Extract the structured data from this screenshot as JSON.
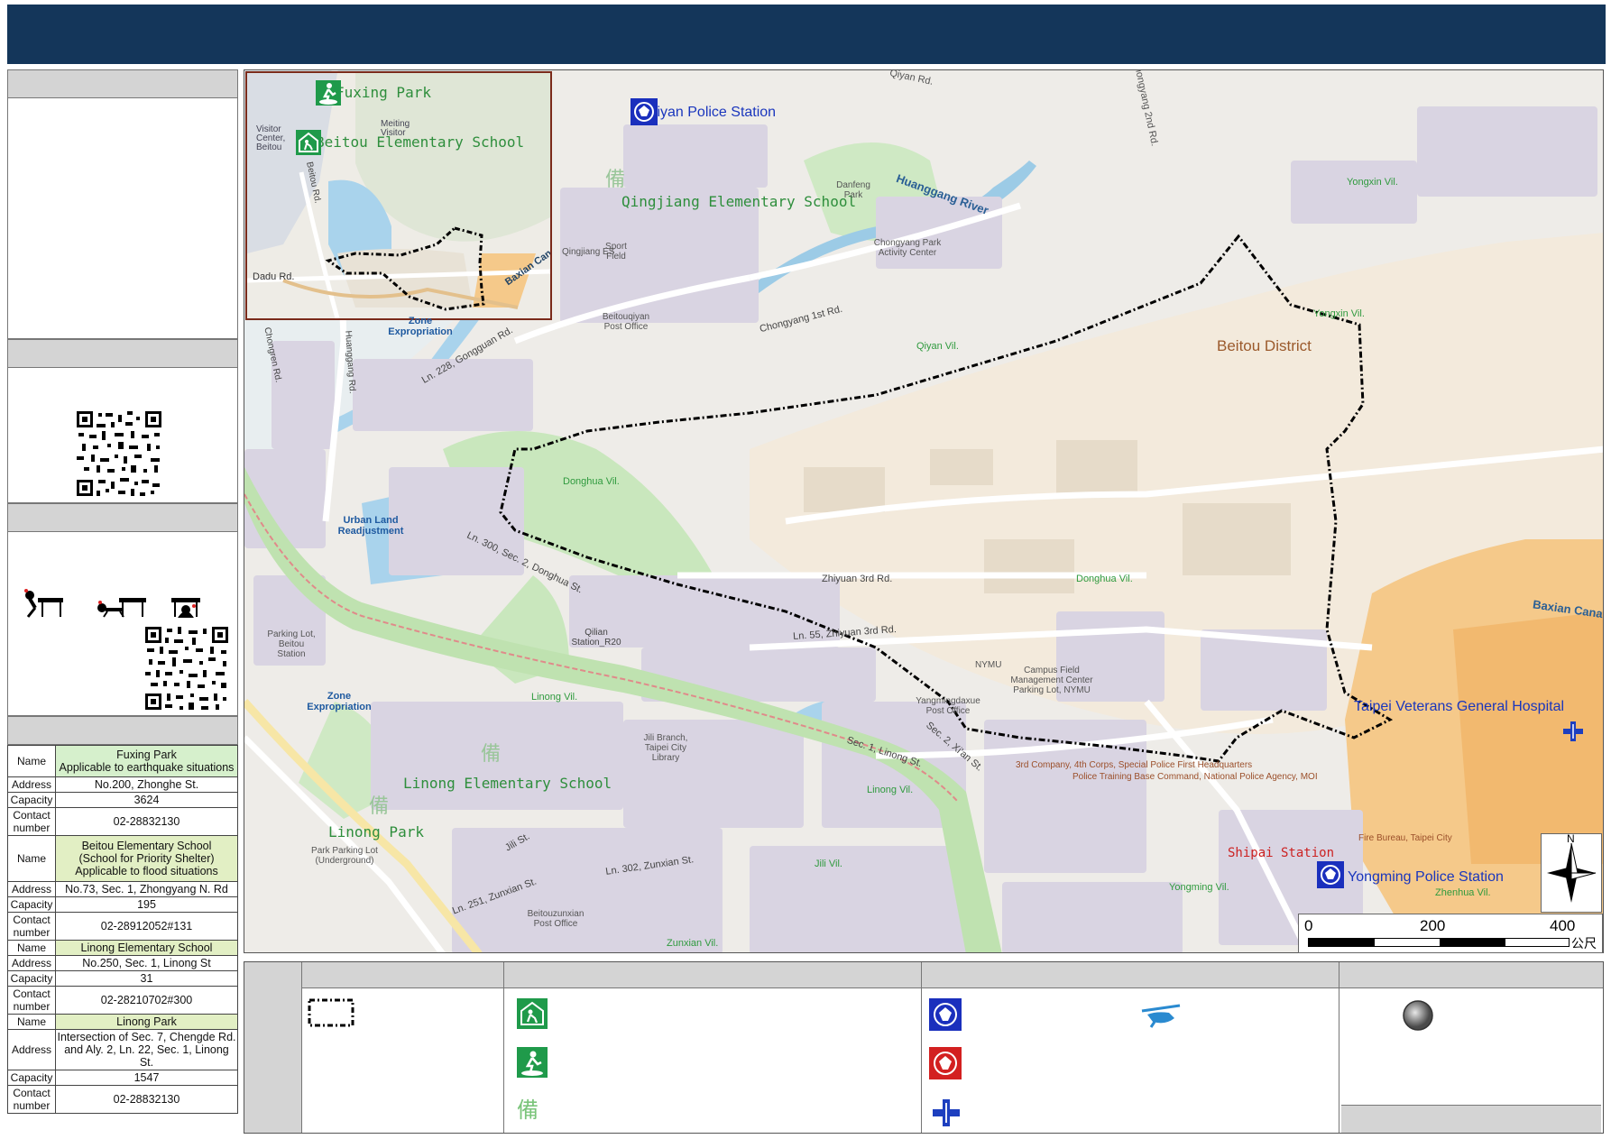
{
  "header": {
    "title": ""
  },
  "left_panel": {
    "facilities": [
      {
        "name": "Fuxing Park",
        "note": "Applicable to earthquake situations",
        "address": "No.200, Zhonghe St.",
        "capacity": "3624",
        "contact": "02-28832130"
      },
      {
        "name": "Beitou Elementary School",
        "note_line1": "(School for Priority Shelter)",
        "note_line2": "Applicable to flood situations",
        "address": "No.73, Sec. 1, Zhongyang N. Rd",
        "capacity": "195",
        "contact": "02-28912052#131"
      },
      {
        "name": "Linong Elementary School",
        "address": "No.250, Sec. 1, Linong St",
        "capacity": "31",
        "contact": "02-28210702#300"
      },
      {
        "name": "Linong Park",
        "address_line1": "Intersection of Sec. 7, Chengde Rd.",
        "address_line2": "and Aly. 2, Ln. 22, Sec. 1, Linong St.",
        "capacity": "1547",
        "contact": "02-28832130"
      }
    ],
    "row_labels": {
      "name": "Name",
      "address": "Address",
      "capacity": "Capacity",
      "contact_1": "Contact",
      "contact_2": "number"
    }
  },
  "map": {
    "district": "Beitou District",
    "shelters": {
      "fuxing_park": "Fuxing Park",
      "beitou_es": "Beitou Elementary School",
      "qingjiang_es": "Qingjiang Elementary School",
      "linong_es": "Linong Elementary School",
      "linong_park": "Linong Park"
    },
    "police": {
      "qiyan": "Qiyan Police Station",
      "yongming": "Yongming Police Station"
    },
    "hospital": "Taipei Veterans General Hospital",
    "mrt": "Shipai Station",
    "basemap_labels": {
      "qiyan_rd": "Qiyan Rd.",
      "chongyang_2nd": "Chongyang 2nd Rd.",
      "huanggang_river": "Huanggang River",
      "qiyan_vil": "Qiyan Vil.",
      "yongxin_vil_1": "Yongxin Vil.",
      "yongxin_vil_2": "Yongxin Vil.",
      "donghua_vil_1": "Donghua Vil.",
      "donghua_vil_2": "Donghua Vil.",
      "linong_vil_1": "Linong Vil.",
      "linong_vil_2": "Linong Vil.",
      "jili_vil": "Jili Vil.",
      "zunxian_vil": "Zunxian Vil.",
      "yongming_vil": "Yongming Vil.",
      "zhenhua_vil": "Zhenhua Vil.",
      "urban_land": "Urban Land Readjustment",
      "zone_exp_1": "Zone Expropriation",
      "zone_exp_2": "Zone Expropriation",
      "zhiyuan_3rd": "Zhiyuan 3rd Rd.",
      "ln55_zhiyuan": "Ln. 55, Zhiyuan 3rd Rd.",
      "ln300_donghua": "Ln. 300, Sec. 2, Donghua St.",
      "ln228_gongguan": "Ln. 228, Gongguan Rd.",
      "chongyang_1st": "Chongyang 1st Rd.",
      "baxian_canal": "Baxian Canal",
      "qilian_station": "Qilian Station_R20",
      "sec1_linong": "Sec. 1, Linong St.",
      "sec2_xian": "Sec. 2, Xi'an St.",
      "ln302_zunxian": "Ln. 302, Zunxian St.",
      "ln251_zunxian": "Ln. 251, Zunxian St.",
      "jili_st": "Jili St.",
      "yangmingdaxue_po": "Yangmingdaxue Post Office",
      "nymu": "NYMU",
      "campus_field": "Campus Field Management Center Parking Lot, NYMU",
      "jili_branch": "Jili Branch, Taipei City Library",
      "beitouzunxian_po": "Beitouzunxian Post Office",
      "beitouqiyan_po": "Beitouqiyan Post Office",
      "third_company": "3rd Company, 4th Corps, Special Police First Headquarters",
      "police_training": "Police Training Base Command, National Police Agency, MOI",
      "fire_bureau": "Fire Bureau, Taipei City",
      "linong_park_parking": "Park Parking Lot (Underground)",
      "parking_beitou_station": "Parking Lot, Beitou Station",
      "danfeng_park": "Danfeng Park",
      "chongyang_park": "Chongyang Park Activity Center",
      "sport_field": "Sport Field",
      "qingjiang_es_small": "Qingjiang ES",
      "chongren_rd": "Chongren Rd.",
      "huanggang_rd": "Huanggang Rd."
    },
    "inset_labels": {
      "fuxing_park": "Fuxing Park",
      "beitou_es": "Beitou Elementary School",
      "dadu_rd": "Dadu Rd.",
      "baxian_canal": "Baxian Can",
      "meeting": "Meiting Visitor",
      "visitor_center": "Visitor Center, Beitou",
      "beitou_rd": "Beitou Rd."
    },
    "scale": {
      "t0": "0",
      "t1": "200",
      "t2": "400",
      "unit": "公尺"
    },
    "north_label": "N"
  },
  "legend": {
    "col1_head": "",
    "col2_head": "",
    "col3_head": "",
    "col4_head": ""
  },
  "colors": {
    "header": "#14365a",
    "shelter_green": "#1f9a4a",
    "police_blue": "#1a2fbd",
    "boundary": "#000000",
    "text_green_label": "#2f9a3e"
  }
}
